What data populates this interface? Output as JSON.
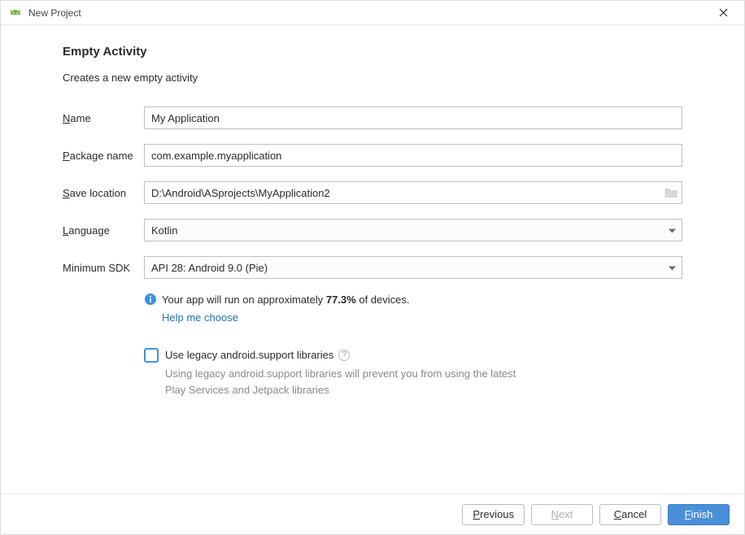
{
  "titlebar": {
    "title": "New Project"
  },
  "heading": "Empty Activity",
  "subtitle": "Creates a new empty activity",
  "labels": {
    "name": {
      "m": "N",
      "rest": "ame"
    },
    "package": {
      "m": "P",
      "rest": "ackage name"
    },
    "save": {
      "m": "S",
      "rest": "ave location"
    },
    "language": {
      "m": "L",
      "rest": "anguage"
    },
    "minsdk": "Minimum SDK"
  },
  "fields": {
    "name": "My Application",
    "package": "com.example.myapplication",
    "save_location": "D:\\Android\\ASprojects\\MyApplication2",
    "language": "Kotlin",
    "minsdk": "API 28: Android 9.0 (Pie)"
  },
  "info": {
    "prefix": "Your app will run on approximately ",
    "pct": "77.3%",
    "suffix": " of devices.",
    "help": "Help me choose"
  },
  "legacy": {
    "label": "Use legacy android.support libraries",
    "hint": "Using legacy android.support libraries will prevent you from using the latest Play Services and Jetpack libraries",
    "checked": false
  },
  "buttons": {
    "previous": {
      "m": "P",
      "rest": "revious"
    },
    "next": {
      "m": "N",
      "rest": "ext"
    },
    "cancel": {
      "m": "C",
      "rest": "ancel"
    },
    "finish": {
      "m": "F",
      "rest": "inish"
    }
  }
}
